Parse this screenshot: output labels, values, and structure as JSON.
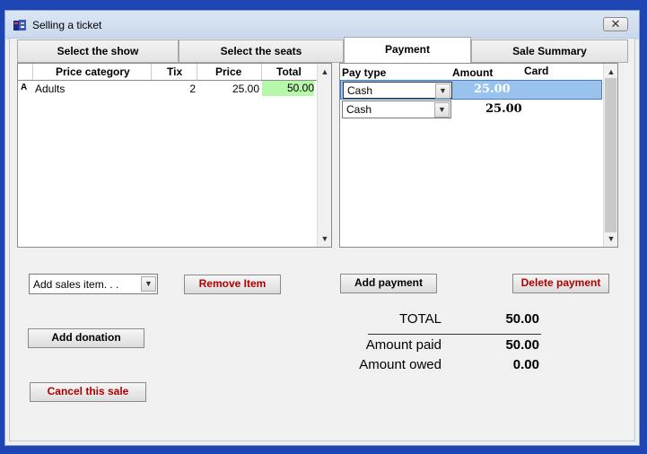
{
  "window": {
    "title": "Selling a ticket",
    "close_glyph": "✕"
  },
  "tabs": [
    "Select the show",
    "Select the seats",
    "Payment",
    "Sale Summary"
  ],
  "items_table": {
    "columns": [
      "Price category",
      "Tix",
      "Price",
      "Total"
    ],
    "rows": [
      {
        "marker": "A",
        "category": "Adults",
        "tix": "2",
        "price": "25.00",
        "total": "50.00"
      }
    ]
  },
  "payment_table": {
    "columns": [
      "Pay type",
      "Amount",
      "Card"
    ],
    "rows": [
      {
        "pay_type": "Cash",
        "amount": "25.00",
        "selected": true
      },
      {
        "pay_type": "Cash",
        "amount": "25.00",
        "selected": false
      }
    ]
  },
  "controls": {
    "add_sales_item": "Add sales item. . .",
    "remove_item": "Remove Item",
    "add_donation": "Add donation",
    "cancel_sale": "Cancel this sale",
    "add_payment": "Add payment",
    "delete_payment": "Delete payment"
  },
  "totals": {
    "total_label": "TOTAL",
    "total_value": "50.00",
    "paid_label": "Amount paid",
    "paid_value": "50.00",
    "owed_label": "Amount owed",
    "owed_value": "0.00"
  },
  "colors": {
    "selection": "#99c2ee",
    "total_highlight": "#b6f7a9",
    "danger_text": "#b00000"
  }
}
